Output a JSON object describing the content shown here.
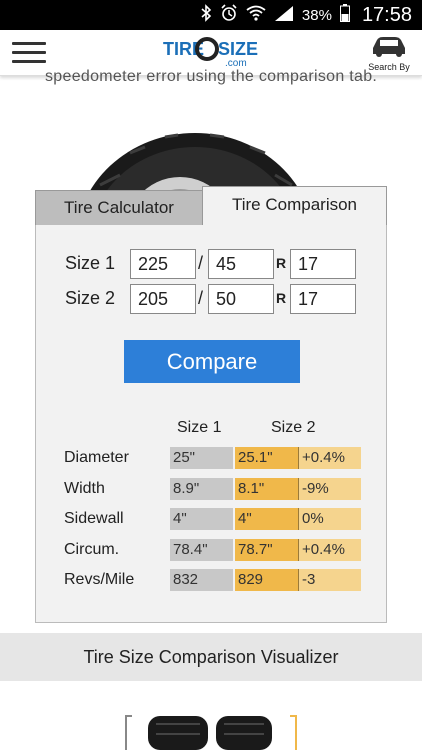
{
  "statusbar": {
    "battery": "38%",
    "time": "17:58"
  },
  "header": {
    "logo_top": "TIRESIZE",
    "logo_sub": ".com",
    "search_by_label": "Search By"
  },
  "intro_partial": "speedometer error using the comparison tab.",
  "tabs": {
    "calculator": "Tire Calculator",
    "comparison": "Tire Comparison"
  },
  "sizes": [
    {
      "label": "Size 1",
      "width": "225",
      "aspect": "45",
      "rim": "17"
    },
    {
      "label": "Size 2",
      "width": "205",
      "aspect": "50",
      "rim": "17"
    }
  ],
  "separators": {
    "slash": "/",
    "r": "R"
  },
  "compare_button": "Compare",
  "results": {
    "col_size1": "Size 1",
    "col_size2": "Size 2",
    "rows": [
      {
        "label": "Diameter",
        "size1": "25\"",
        "size2": "25.1\"",
        "diff": "+0.4%"
      },
      {
        "label": "Width",
        "size1": "8.9\"",
        "size2": "8.1\"",
        "diff": "-9%"
      },
      {
        "label": "Sidewall",
        "size1": "4\"",
        "size2": "4\"",
        "diff": "0%"
      },
      {
        "label": "Circum.",
        "size1": "78.4\"",
        "size2": "78.7\"",
        "diff": "+0.4%"
      },
      {
        "label": "Revs/Mile",
        "size1": "832",
        "size2": "829",
        "diff": "-3"
      }
    ]
  },
  "visualizer_title": "Tire Size Comparison Visualizer",
  "colors": {
    "accent": "#2d7fd8",
    "size2_cell": "#f0b84a",
    "diff_cell": "#f5d48e",
    "size1_cell": "#c8c8c8"
  }
}
